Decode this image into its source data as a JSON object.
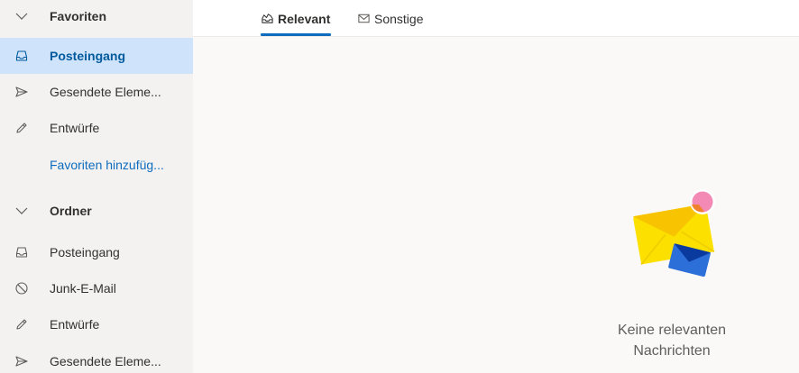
{
  "sidebar": {
    "favorites_header": "Favoriten",
    "favorites": [
      {
        "label": "Posteingang",
        "icon": "inbox-icon",
        "selected": true
      },
      {
        "label": "Gesendete Eleme...",
        "icon": "send-icon"
      },
      {
        "label": "Entwürfe",
        "icon": "pencil-icon"
      },
      {
        "label": "Favoriten hinzufüg...",
        "icon": "",
        "link": true
      }
    ],
    "folders_header": "Ordner",
    "folders": [
      {
        "label": "Posteingang",
        "icon": "inbox-icon"
      },
      {
        "label": "Junk-E-Mail",
        "icon": "blocked-icon"
      },
      {
        "label": "Entwürfe",
        "icon": "pencil-icon"
      },
      {
        "label": "Gesendete Eleme...",
        "icon": "send-icon"
      }
    ]
  },
  "tabs": [
    {
      "label": "Relevant",
      "icon": "focused-inbox-icon",
      "active": true
    },
    {
      "label": "Sonstige",
      "icon": "mail-icon",
      "active": false
    }
  ],
  "empty_state": {
    "line1": "Keine relevanten",
    "line2": "Nachrichten",
    "icon": "envelopes-illustration"
  },
  "colors": {
    "accent": "#0f6cbd",
    "selected_bg": "#cfe4fa",
    "sidebar_bg": "#f3f2f1",
    "content_bg": "#faf9f8"
  }
}
